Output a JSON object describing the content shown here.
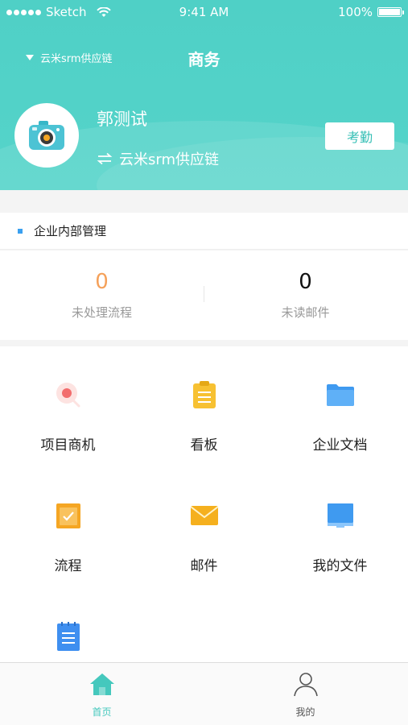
{
  "status_bar": {
    "carrier": "Sketch",
    "time": "9:41 AM",
    "battery": "100%"
  },
  "nav": {
    "org_switch_label": "云米srm供应链",
    "title": "商务"
  },
  "profile": {
    "name": "郭测试",
    "org": "云米srm供应链",
    "attendance_button": "考勤"
  },
  "section": {
    "title": "企业内部管理"
  },
  "stats": [
    {
      "value": "0",
      "label": "未处理流程",
      "color": "#f5a15a"
    },
    {
      "value": "0",
      "label": "未读邮件",
      "color": "#111111"
    }
  ],
  "grid_items": [
    {
      "label": "项目商机",
      "icon": "opportunity-icon"
    },
    {
      "label": "看板",
      "icon": "clipboard-icon"
    },
    {
      "label": "企业文档",
      "icon": "folder-icon"
    },
    {
      "label": "流程",
      "icon": "checklist-icon"
    },
    {
      "label": "邮件",
      "icon": "mail-icon"
    },
    {
      "label": "我的文件",
      "icon": "monitor-icon"
    },
    {
      "label": "",
      "icon": "notepad-icon"
    }
  ],
  "tabbar": {
    "home_label": "首页",
    "mine_label": "我的",
    "active_color": "#45c8bd",
    "inactive_color": "#555555"
  },
  "colors": {
    "brand": "#4fd0c6",
    "accent_blue": "#3aa0f0"
  }
}
